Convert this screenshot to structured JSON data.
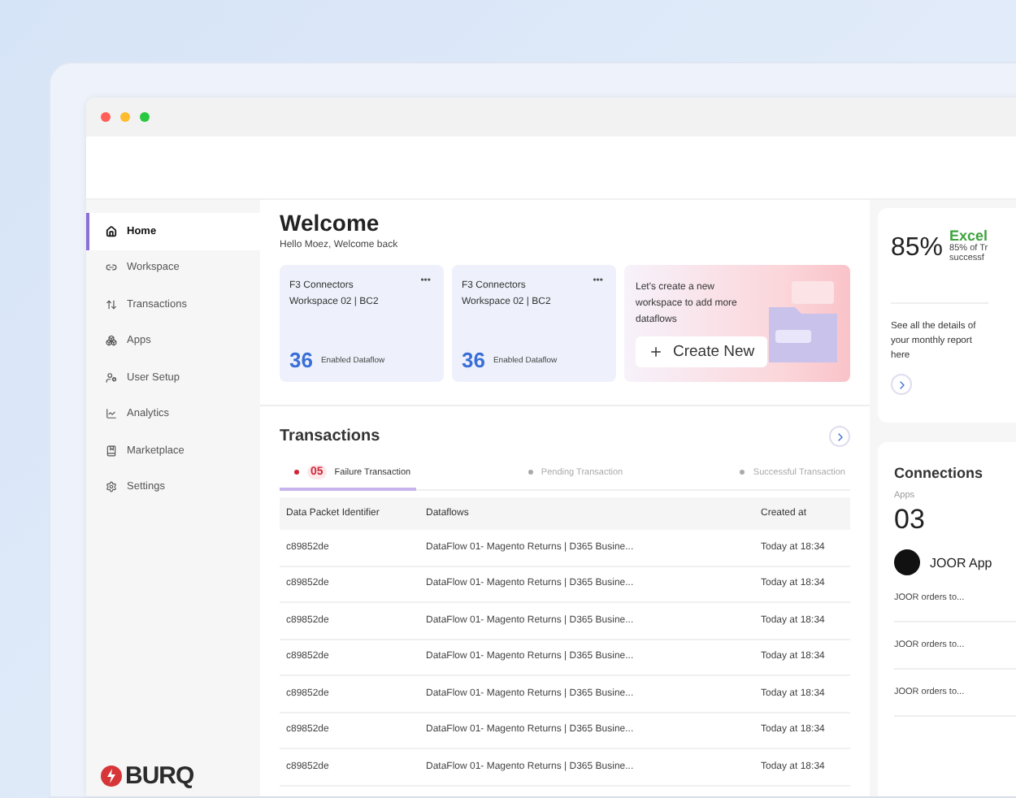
{
  "sidebar": {
    "items": [
      {
        "label": "Home",
        "selected": true
      },
      {
        "label": "Workspace",
        "selected": false
      },
      {
        "label": "Transactions",
        "selected": false
      },
      {
        "label": "Apps",
        "selected": false
      },
      {
        "label": "User Setup",
        "selected": false
      },
      {
        "label": "Analytics",
        "selected": false
      },
      {
        "label": "Marketplace",
        "selected": false
      },
      {
        "label": "Settings",
        "selected": false
      }
    ],
    "logo": "BURQ"
  },
  "welcome": {
    "title": "Welcome",
    "subtitle": "Hello Moez, Welcome back"
  },
  "workspace_cards": [
    {
      "title": "F3 Connectors",
      "subtitle": "Workspace 02 | BC2",
      "menu": "•••",
      "count": "36",
      "count_label": "Enabled Dataflow"
    },
    {
      "title": "F3 Connectors",
      "subtitle": "Workspace 02 | BC2",
      "menu": "•••",
      "count": "36",
      "count_label": "Enabled Dataflow"
    }
  ],
  "promo": {
    "text": "Let's create a new workspace to add more dataflows",
    "button": "Create New"
  },
  "transactions": {
    "title": "Transactions",
    "tabs": [
      {
        "label": "Failure Transaction",
        "count": "05",
        "selected": true
      },
      {
        "label": "Pending Transaction",
        "selected": false
      },
      {
        "label": "Successful Transaction",
        "selected": false
      }
    ],
    "table": {
      "columns": [
        "Data Packet Identifier",
        "Dataflows",
        "Created at"
      ],
      "rows": [
        [
          "c89852de",
          "DataFlow 01- Magento Returns | D365 Busine...",
          "Today at 18:34"
        ],
        [
          "c89852de",
          "DataFlow 01- Magento Returns | D365 Busine...",
          "Today at 18:34"
        ],
        [
          "c89852de",
          "DataFlow 01- Magento Returns | D365 Busine...",
          "Today at 18:34"
        ],
        [
          "c89852de",
          "DataFlow 01- Magento Returns | D365 Busine...",
          "Today at 18:34"
        ],
        [
          "c89852de",
          "DataFlow 01- Magento Returns | D365 Busine...",
          "Today at 18:34"
        ],
        [
          "c89852de",
          "DataFlow 01- Magento Returns | D365 Busine...",
          "Today at 18:34"
        ],
        [
          "c89852de",
          "DataFlow 01- Magento Returns | D365 Busine...",
          "Today at 18:34"
        ]
      ]
    }
  },
  "report": {
    "percent": "85%",
    "rating": "Excel",
    "detail_lines": [
      "85% of Tr",
      "successf"
    ],
    "text": "See all the details of your monthly report here"
  },
  "connections": {
    "title": "Connections",
    "apps_label": "Apps",
    "apps_count": "03",
    "app_name": "JOOR App",
    "items": [
      "JOOR orders to...",
      "JOOR orders to...",
      "JOOR orders to..."
    ]
  }
}
